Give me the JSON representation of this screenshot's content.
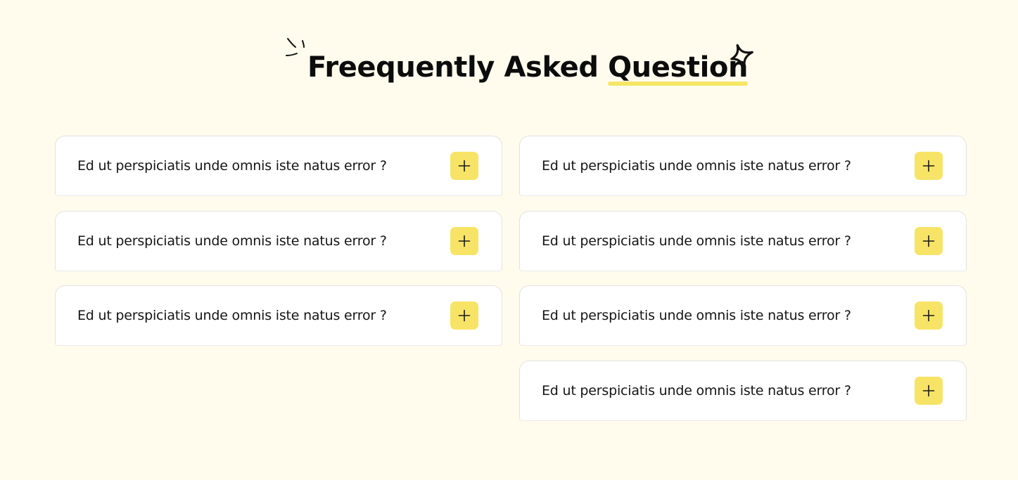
{
  "header": {
    "title_plain": "Freequently Asked ",
    "title_highlight": "Question",
    "highlight_color": "#f6e666",
    "decorations": [
      "spark-lines-icon",
      "sparkle-icon"
    ]
  },
  "faq": {
    "toggle_icon": "plus-icon",
    "toggle_color": "#f7e466",
    "left": [
      {
        "question": "Ed ut perspiciatis unde omnis iste natus error ?"
      },
      {
        "question": "Ed ut perspiciatis unde omnis iste natus error ?"
      },
      {
        "question": "Ed ut perspiciatis unde omnis iste natus error ?"
      }
    ],
    "right": [
      {
        "question": "Ed ut perspiciatis unde omnis iste natus error ?"
      },
      {
        "question": "Ed ut perspiciatis unde omnis iste natus error ?"
      },
      {
        "question": "Ed ut perspiciatis unde omnis iste natus error ?"
      },
      {
        "question": "Ed ut perspiciatis unde omnis iste natus error ?"
      }
    ]
  }
}
